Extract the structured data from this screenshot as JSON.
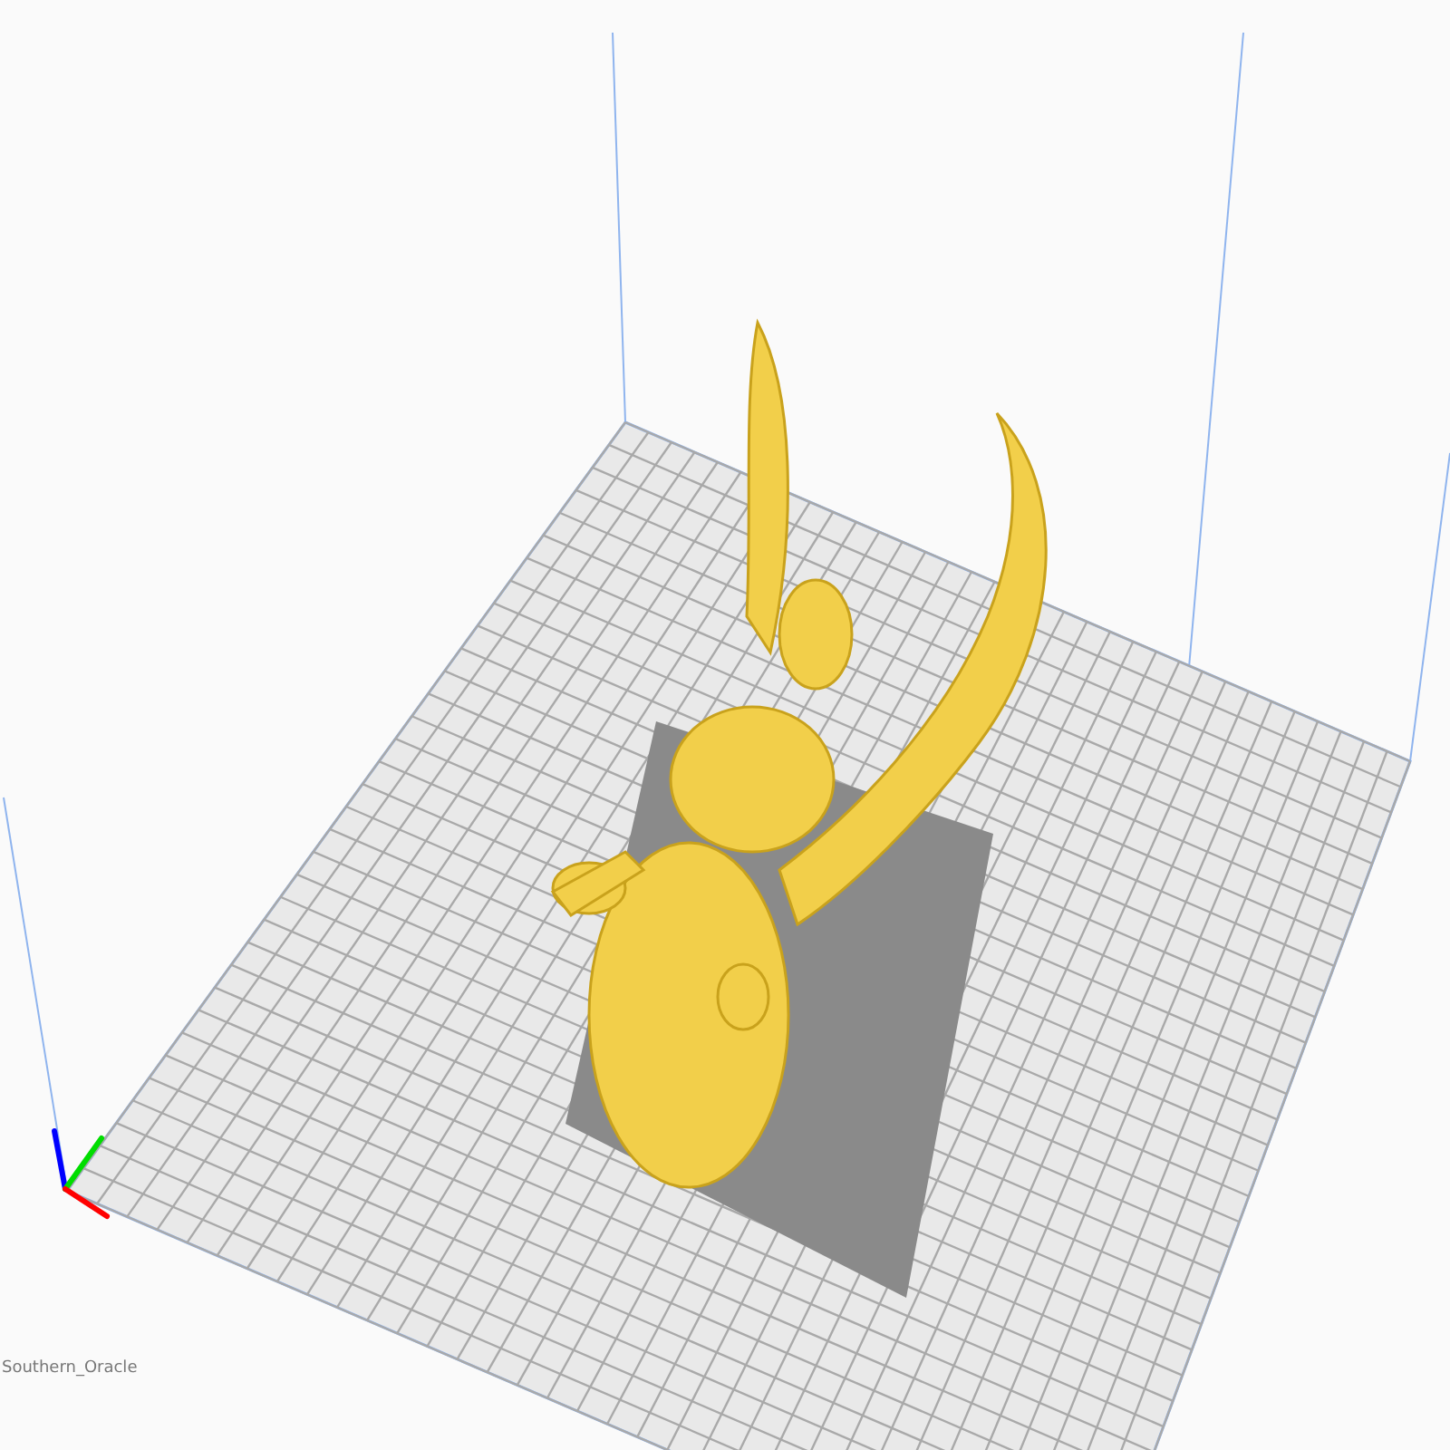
{
  "viewport": {
    "model_name": "Southern_Oracle"
  }
}
